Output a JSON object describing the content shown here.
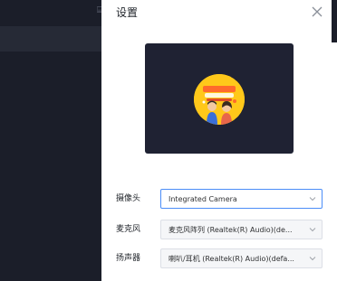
{
  "background": {
    "glyph": "⌸"
  },
  "drawer": {
    "title": "设置"
  },
  "camera": {
    "label": "摄像头",
    "value": "Integrated Camera"
  },
  "microphone": {
    "label": "麦克风",
    "value": "麦克风阵列 (Realtek(R) Audio)(de..."
  },
  "speaker": {
    "label": "扬声器",
    "value": "喇叭/耳机 (Realtek(R) Audio)(defa..."
  },
  "colors": {
    "accent": "#4b8df8",
    "dark_bg": "#1b1e29",
    "preview_bg": "#1f2233",
    "avatar_bg": "#ffc81a"
  }
}
